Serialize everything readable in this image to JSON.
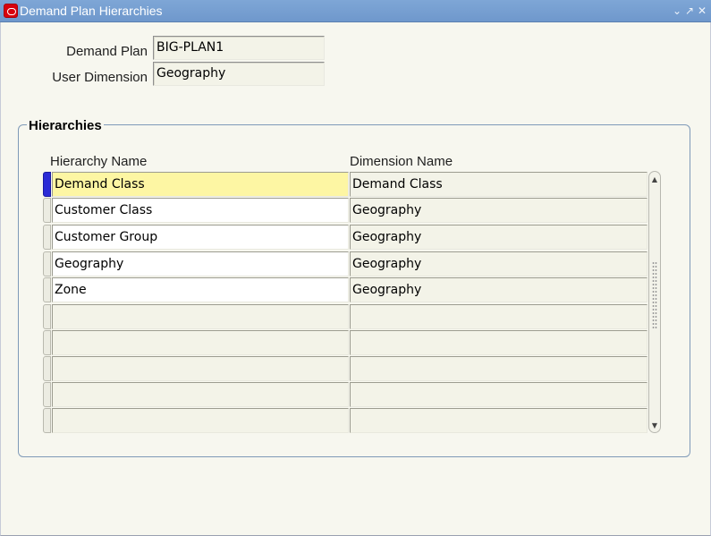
{
  "window": {
    "title": "Demand Plan Hierarchies",
    "buttons": {
      "minimize": "⌄",
      "maximize": "↗",
      "close": "✕"
    }
  },
  "form": {
    "demand_plan_label": "Demand Plan",
    "demand_plan_value": "BIG-PLAN1",
    "user_dimension_label": "User Dimension",
    "user_dimension_value": "Geography"
  },
  "hierarchies": {
    "group_title": "Hierarchies",
    "columns": {
      "hierarchy_name": "Hierarchy Name",
      "dimension_name": "Dimension Name"
    },
    "rows": [
      {
        "hierarchy_name": "Demand Class",
        "dimension_name": "Demand Class"
      },
      {
        "hierarchy_name": "Customer Class",
        "dimension_name": "Geography"
      },
      {
        "hierarchy_name": "Customer Group",
        "dimension_name": "Geography"
      },
      {
        "hierarchy_name": "Geography",
        "dimension_name": "Geography"
      },
      {
        "hierarchy_name": "Zone",
        "dimension_name": "Geography"
      },
      {
        "hierarchy_name": "",
        "dimension_name": ""
      },
      {
        "hierarchy_name": "",
        "dimension_name": ""
      },
      {
        "hierarchy_name": "",
        "dimension_name": ""
      },
      {
        "hierarchy_name": "",
        "dimension_name": ""
      },
      {
        "hierarchy_name": "",
        "dimension_name": ""
      }
    ]
  },
  "colors": {
    "titlebar": "#7ea6d6",
    "current_row": "#fdf6a3",
    "row_indicator": "#2b2bd6"
  },
  "icons": {
    "app": "oracle-logo-icon",
    "scroll_up": "arrow-up-icon",
    "scroll_down": "arrow-down-icon"
  }
}
